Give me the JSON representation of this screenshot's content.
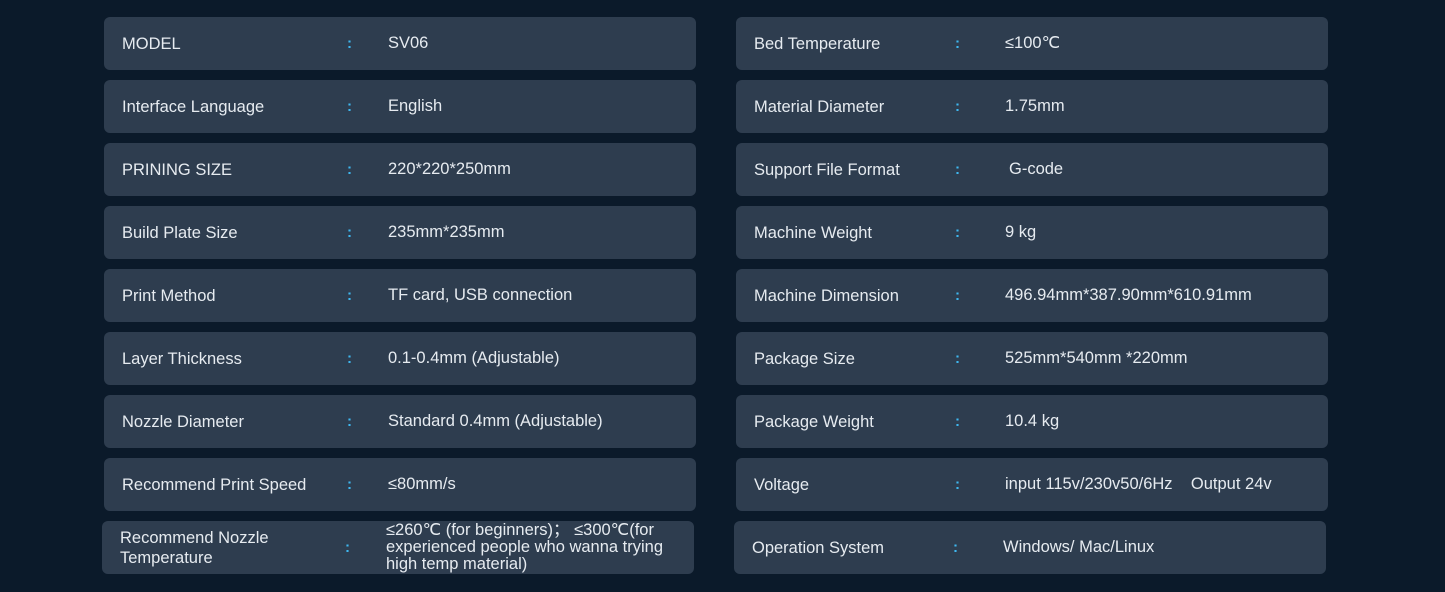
{
  "left_rows": [
    {
      "label": "MODEL",
      "sep": ":",
      "value": "SV06"
    },
    {
      "label": "Interface Language",
      "sep": ":",
      "value": "English"
    },
    {
      "label": "PRINING SIZE",
      "sep": ":",
      "value": "220*220*250mm"
    },
    {
      "label": "Build Plate Size",
      "sep": ":",
      "value": "235mm*235mm"
    },
    {
      "label": "Print Method",
      "sep": ":",
      "value": "TF card, USB connection"
    },
    {
      "label": "Layer Thickness",
      "sep": ":",
      "value": "0.1-0.4mm (Adjustable)"
    },
    {
      "label": "Nozzle Diameter",
      "sep": ":",
      "value": "Standard 0.4mm (Adjustable)"
    },
    {
      "label": "Recommend Print Speed",
      "sep": ":",
      "value": "≤80mm/s"
    },
    {
      "label": "Recommend Nozzle Temperature",
      "sep": ":",
      "value": "≤260℃ (for beginners)； ≤300℃(for experienced people who wanna trying high temp material)"
    }
  ],
  "right_rows": [
    {
      "label": "Bed Temperature",
      "sep": ":",
      "value": "≤100℃"
    },
    {
      "label": "Material Diameter",
      "sep": ":",
      "value": "1.75mm"
    },
    {
      "label": "Support File Format",
      "sep": ":",
      "value": "G-code"
    },
    {
      "label": "Machine Weight",
      "sep": ":",
      "value": "9 kg"
    },
    {
      "label": "Machine Dimension",
      "sep": ":",
      "value": "496.94mm*387.90mm*610.91mm"
    },
    {
      "label": "Package Size",
      "sep": ":",
      "value": "525mm*540mm *220mm"
    },
    {
      "label": "Package Weight",
      "sep": ":",
      "value": "10.4 kg"
    },
    {
      "label": "Voltage",
      "sep": ":",
      "value": "input 115v/230v50/6Hz    Output 24v"
    },
    {
      "label": "Operation System",
      "sep": ":",
      "value": "Windows/ Mac/Linux"
    }
  ],
  "colors": {
    "background": "#0b1a2a",
    "row": "#2e3d4f",
    "separator": "#3fb8f0",
    "text": "#e6ebf0"
  }
}
